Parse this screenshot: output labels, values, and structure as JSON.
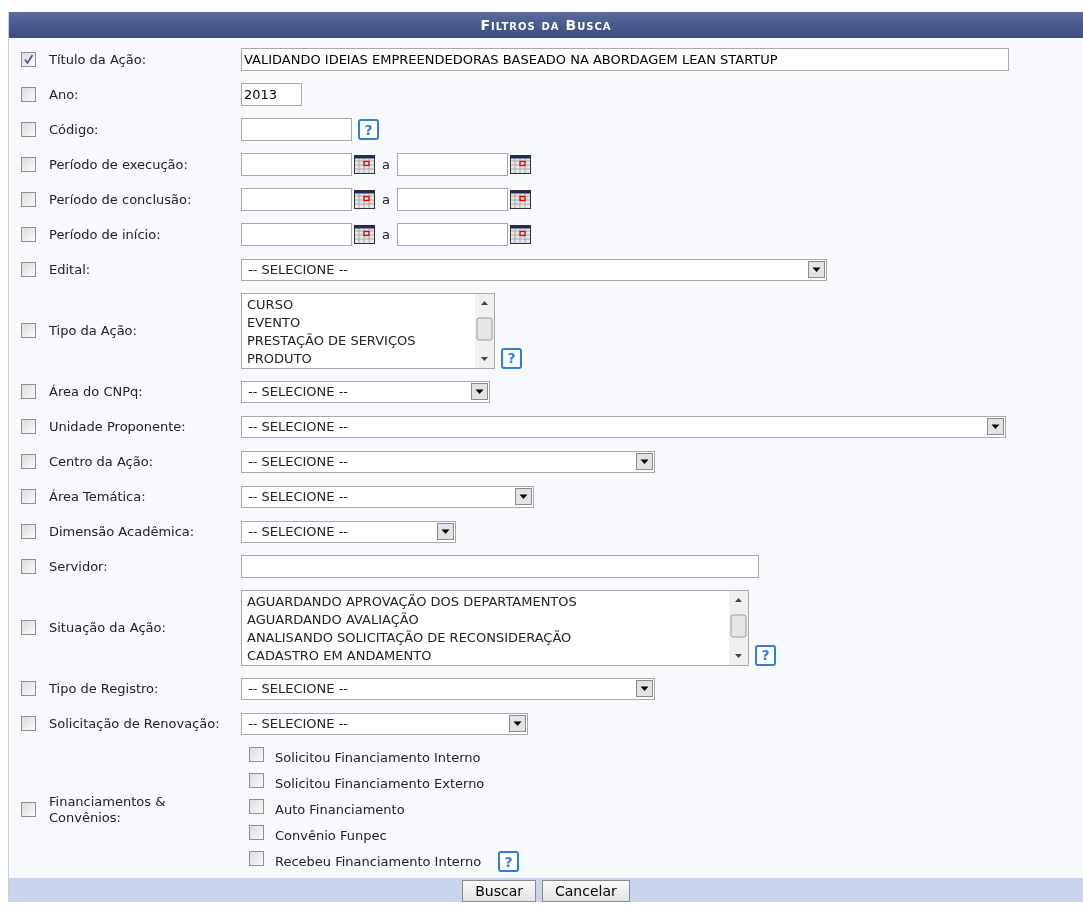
{
  "header": {
    "title": "Filtros da Busca"
  },
  "filters": [
    {
      "kind": "text",
      "checked": true,
      "label": "Título da Ação:",
      "value": "VALIDANDO IDEIAS EMPREENDEDORAS BASEADO NA ABORDAGEM LEAN STARTUP"
    },
    {
      "kind": "text",
      "checked": false,
      "label": "Ano:",
      "value": "2013"
    },
    {
      "kind": "text",
      "checked": false,
      "label": "Código:",
      "help": "?"
    },
    {
      "kind": "daterange",
      "checked": false,
      "label": "Período de execução:",
      "separator": "a"
    },
    {
      "kind": "daterange",
      "checked": false,
      "label": "Período de conclusão:",
      "separator": "a"
    },
    {
      "kind": "daterange",
      "checked": false,
      "label": "Período de início:",
      "separator": "a"
    },
    {
      "kind": "select",
      "checked": false,
      "label": "Edital:",
      "value": "-- SELECIONE --"
    },
    {
      "kind": "listbox",
      "checked": false,
      "label": "Tipo da Ação:",
      "options": [
        "CURSO",
        "EVENTO",
        "PRESTAÇÃO DE SERVIÇOS",
        "PRODUTO"
      ],
      "help": "?"
    },
    {
      "kind": "select",
      "checked": false,
      "label": "Área do CNPq:",
      "value": "-- SELECIONE --"
    },
    {
      "kind": "select",
      "checked": false,
      "label": "Unidade Proponente:",
      "value": "-- SELECIONE --"
    },
    {
      "kind": "select",
      "checked": false,
      "label": "Centro da Ação:",
      "value": "-- SELECIONE --"
    },
    {
      "kind": "select",
      "checked": false,
      "label": "Área Temática:",
      "value": "-- SELECIONE --"
    },
    {
      "kind": "select",
      "checked": false,
      "label": "Dimensão Acadêmica:",
      "value": "-- SELECIONE --"
    },
    {
      "kind": "text",
      "checked": false,
      "label": "Servidor:"
    },
    {
      "kind": "listbox",
      "checked": false,
      "label": "Situação da Ação:",
      "options": [
        "AGUARDANDO APROVAÇÃO DOS DEPARTAMENTOS",
        "AGUARDANDO AVALIAÇÃO",
        "ANALISANDO SOLICITAÇÃO DE RECONSIDERAÇÃO",
        "CADASTRO EM ANDAMENTO"
      ],
      "help": "?"
    },
    {
      "kind": "select",
      "checked": false,
      "label": "Tipo de Registro:",
      "value": "-- SELECIONE --"
    },
    {
      "kind": "select",
      "checked": false,
      "label": "Solicitação de Renovação:",
      "value": "-- SELECIONE --"
    },
    {
      "kind": "checks",
      "checked": false,
      "label": "Financiamentos & Convênios:",
      "options": [
        {
          "label": "Solicitou Financiamento Interno",
          "checked": false
        },
        {
          "label": "Solicitou Financiamento Externo",
          "checked": false
        },
        {
          "label": "Auto Financiamento",
          "checked": false
        },
        {
          "label": "Convênio Funpec",
          "checked": false
        },
        {
          "label": "Recebeu Financiamento Interno",
          "checked": false
        }
      ],
      "help": "?"
    }
  ],
  "buttons": [
    "Buscar",
    "Cancelar"
  ]
}
